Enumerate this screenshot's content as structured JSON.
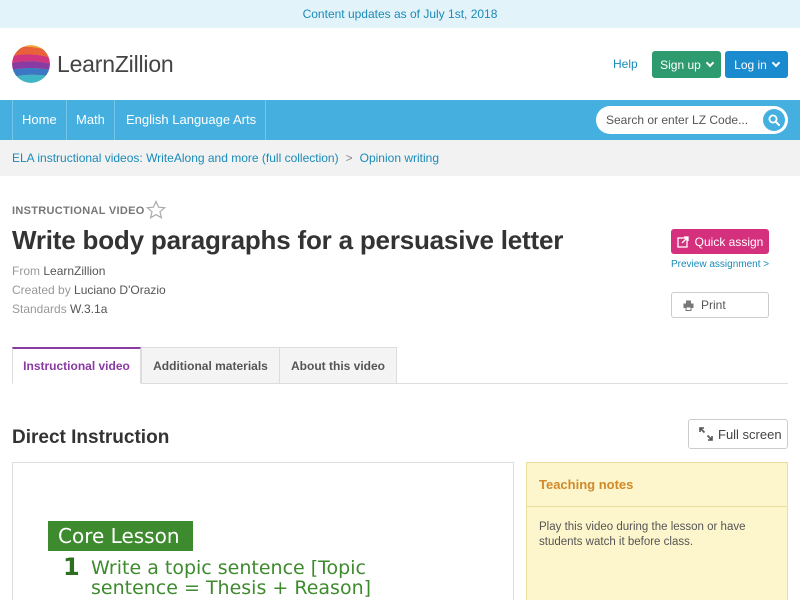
{
  "banner": {
    "text": "Content updates as of July 1st, 2018"
  },
  "header": {
    "logo_text": "LearnZillion",
    "help_label": "Help",
    "signup_label": "Sign up",
    "login_label": "Log in"
  },
  "nav": {
    "items": [
      {
        "label": "Home"
      },
      {
        "label": "Math"
      },
      {
        "label": "English Language Arts"
      }
    ],
    "search_placeholder": "Search or enter LZ Code..."
  },
  "breadcrumb": {
    "parent": "ELA instructional videos: WriteAlong and more (full collection)",
    "separator": ">",
    "current": "Opinion writing"
  },
  "lesson": {
    "type_label": "INSTRUCTIONAL VIDEO",
    "title": "Write body paragraphs for a persuasive letter",
    "from_label": "From",
    "from_value": "LearnZillion",
    "created_label": "Created by",
    "created_value": "Luciano D'Orazio",
    "standards_label": "Standards",
    "standards_value": "W.3.1a"
  },
  "actions": {
    "quick_assign_label": "Quick assign",
    "preview_label": "Preview assignment >",
    "print_label": "Print"
  },
  "tabs": [
    {
      "label": "Instructional video",
      "active": true
    },
    {
      "label": "Additional materials",
      "active": false
    },
    {
      "label": "About this video",
      "active": false
    }
  ],
  "section": {
    "title": "Direct Instruction",
    "fullscreen_label": "Full screen"
  },
  "video": {
    "core_label": "Core Lesson",
    "step_number": "1",
    "line1": "Write a topic sentence [Topic",
    "line2": "sentence = Thesis + Reason]"
  },
  "teaching_notes": {
    "title": "Teaching notes",
    "body": "Play this video during the lesson or have students watch it before class."
  },
  "colors": {
    "nav_blue": "#45b0e0",
    "signup_green": "#2e9b6e",
    "login_blue": "#1a8bcf",
    "quick_assign_pink": "#d5307d",
    "active_tab_purple": "#8a3aa3",
    "notes_yellow": "#fdf5cc"
  }
}
